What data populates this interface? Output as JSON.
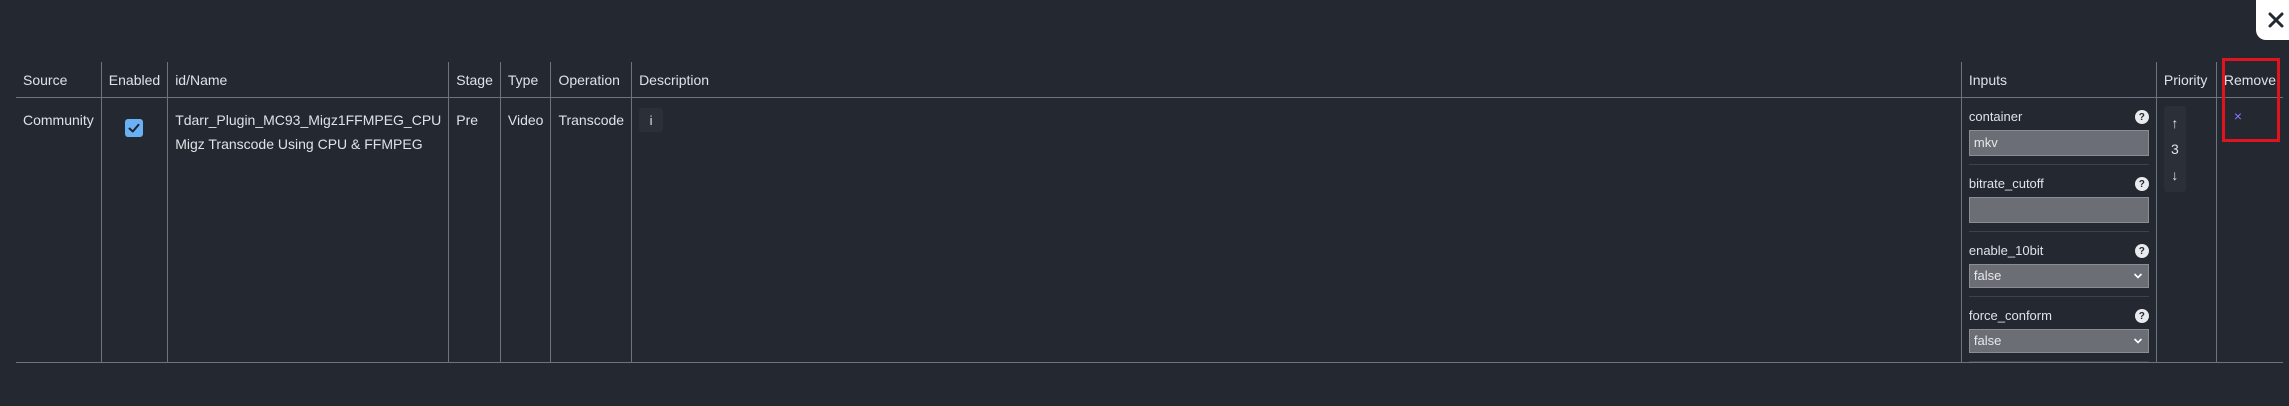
{
  "close_glyph": "✕",
  "table": {
    "headers": {
      "source": "Source",
      "enabled": "Enabled",
      "id_name": "id/Name",
      "stage": "Stage",
      "type": "Type",
      "operation": "Operation",
      "description": "Description",
      "inputs": "Inputs",
      "priority": "Priority",
      "remove": "Remove"
    },
    "row": {
      "source": "Community",
      "enabled": true,
      "id": "Tdarr_Plugin_MC93_Migz1FFMPEG_CPU",
      "name": "Migz Transcode Using CPU & FFMPEG",
      "stage": "Pre",
      "type": "Video",
      "operation": "Transcode",
      "description_button": "i",
      "inputs": {
        "container": {
          "label": "container",
          "value": "mkv"
        },
        "bitrate_cutoff": {
          "label": "bitrate_cutoff",
          "value": ""
        },
        "enable_10bit": {
          "label": "enable_10bit",
          "value": "false"
        },
        "force_conform": {
          "label": "force_conform",
          "value": "false"
        }
      },
      "help_glyph": "?",
      "priority": {
        "up": "↑",
        "value": "3",
        "down": "↓"
      },
      "remove_glyph": "×"
    }
  },
  "colors": {
    "background": "#242830",
    "accent_checkbox": "#6ab0f5",
    "remove_x": "#8f73ff",
    "highlight": "#e0141e"
  }
}
